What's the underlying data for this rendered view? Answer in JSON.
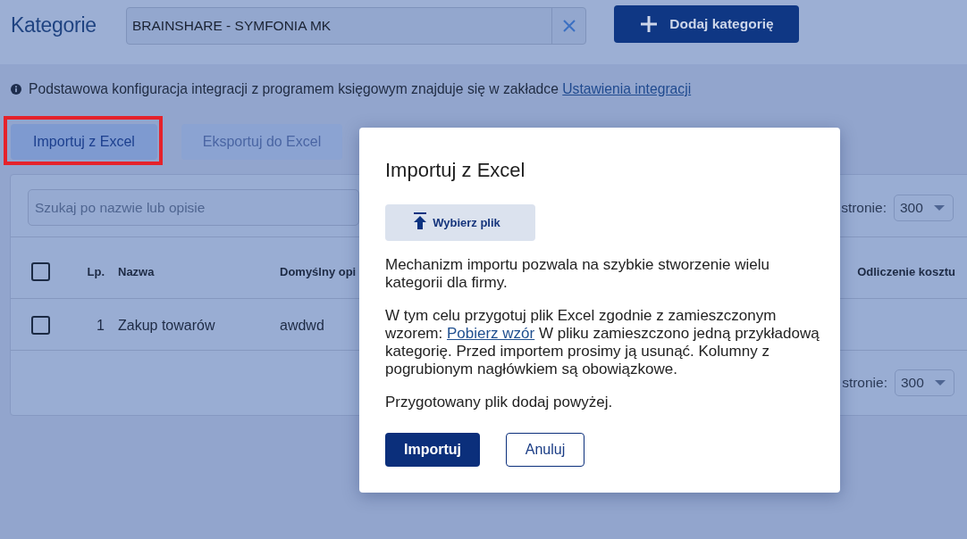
{
  "header": {
    "title": "Kategorie",
    "company_select": {
      "value": "BRAINSHARE - SYMFONIA MK"
    },
    "add_button": {
      "label": "Dodaj kategorię"
    }
  },
  "info": {
    "text": "Podstawowa konfiguracja integracji z programem księgowym znajduje się w zakładce",
    "link": "Ustawienia integracji"
  },
  "toolbar": [
    {
      "label": "Importuj z Excel",
      "disabled": false,
      "highlighted": true
    },
    {
      "label": "Eksportuj do Excel",
      "disabled": true,
      "highlighted": false
    }
  ],
  "table": {
    "search": {
      "placeholder": "Szukaj po nazwie lub opisie"
    },
    "page_size_top": {
      "label": "stronie:",
      "value": "300"
    },
    "header_checked": false,
    "columns": [
      "Lp.",
      "Nazwa",
      "Domyślny opi",
      "Odliczenie kosztu"
    ],
    "rows": [
      {
        "checked": false,
        "cells": [
          "1",
          "Zakup towarów",
          "awdwd"
        ]
      }
    ],
    "page_size_bottom": {
      "label": "stronie:",
      "value": "300"
    }
  },
  "dialog": {
    "title": "Importuj z Excel",
    "file_button": "Wybierz plik",
    "paragraphs": [
      {
        "text": "Mechanizm importu pozwala na szybkie stworzenie wielu kategorii dla firmy."
      },
      {
        "text": "W tym celu przygotuj plik Excel zgodnie z zamieszczonym wzorem:",
        "link": "Pobierz wzór",
        "after": "W pliku zamieszczono jedną przykładową kategorię. Przed importem prosimy ją usunąć. Kolumny z pogrubionym nagłówkiem są obowiązkowe."
      },
      {
        "text": "Przygotowany plik dodaj powyżej."
      }
    ],
    "buttons": [
      {
        "label": "Importuj",
        "kind": "primary"
      },
      {
        "label": "Anuluj",
        "kind": "secondary"
      }
    ]
  }
}
